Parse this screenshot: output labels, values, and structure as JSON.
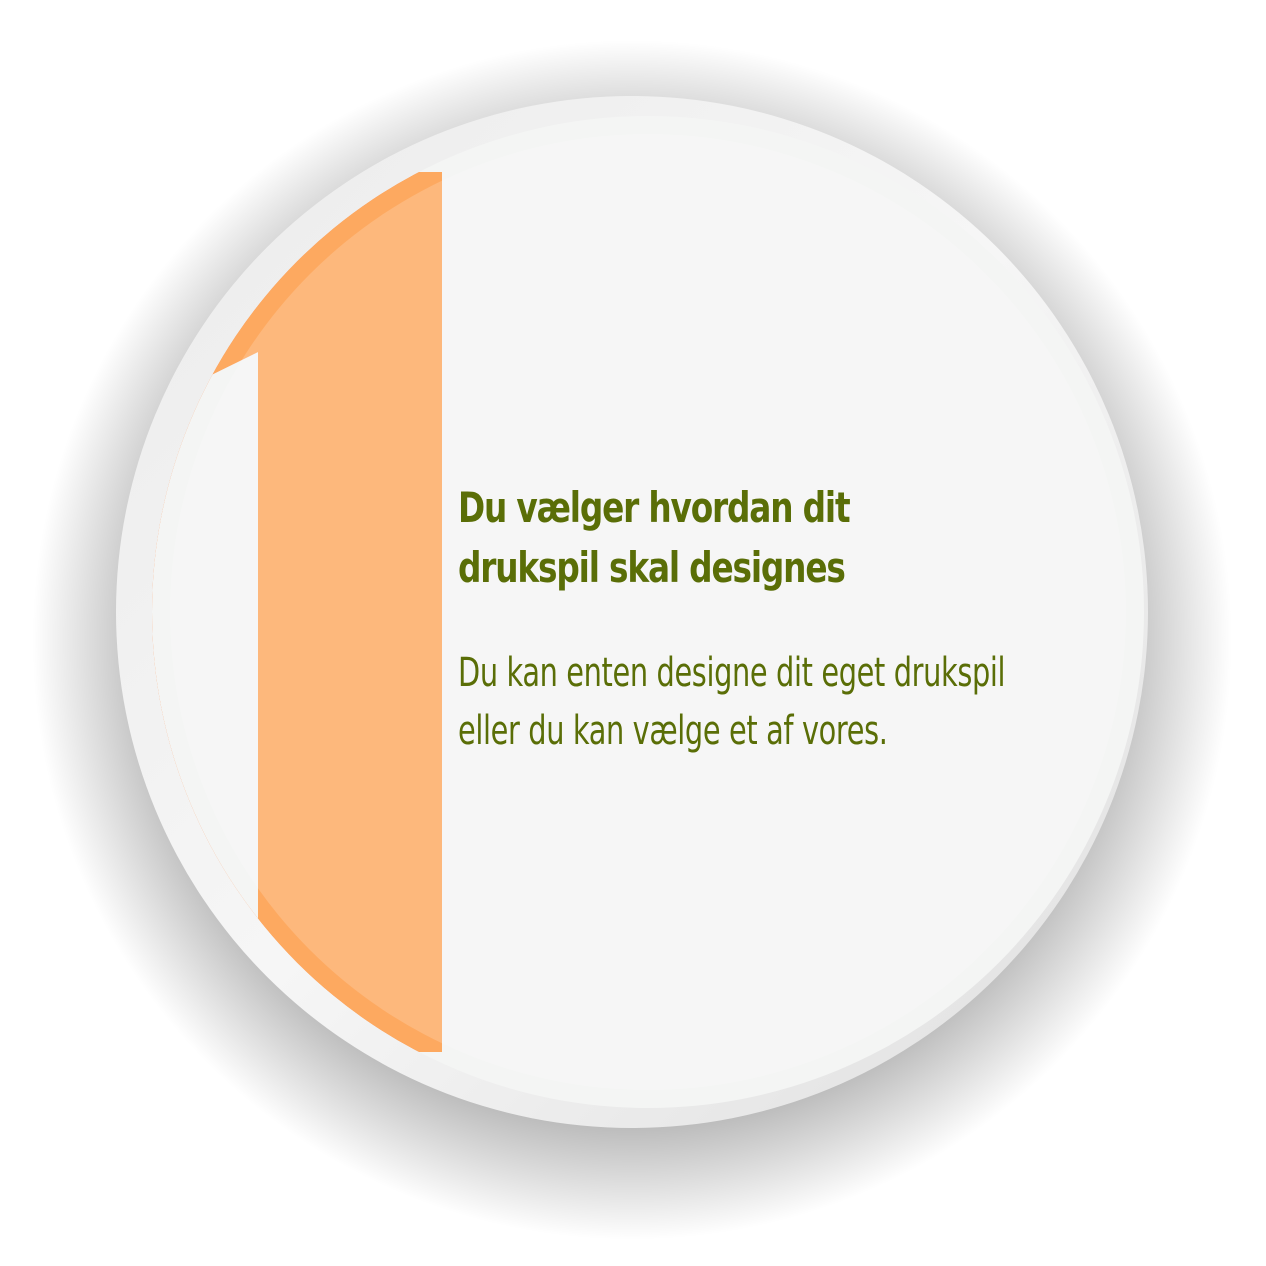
{
  "badge": {
    "numeral": "1",
    "heading_lines": [
      "Du vælger hvordan dit",
      "drukspil skal designes"
    ],
    "body_lines": [
      "Du kan enten designe dit eget drukspil",
      "eller du kan vælge et af vores."
    ]
  },
  "colors": {
    "accent_orange": "#ff7322",
    "numeral_orange": "#fda960",
    "text_green": "#5a6e07",
    "face": "#f4f5f4",
    "rim": "#e4e4e4"
  }
}
